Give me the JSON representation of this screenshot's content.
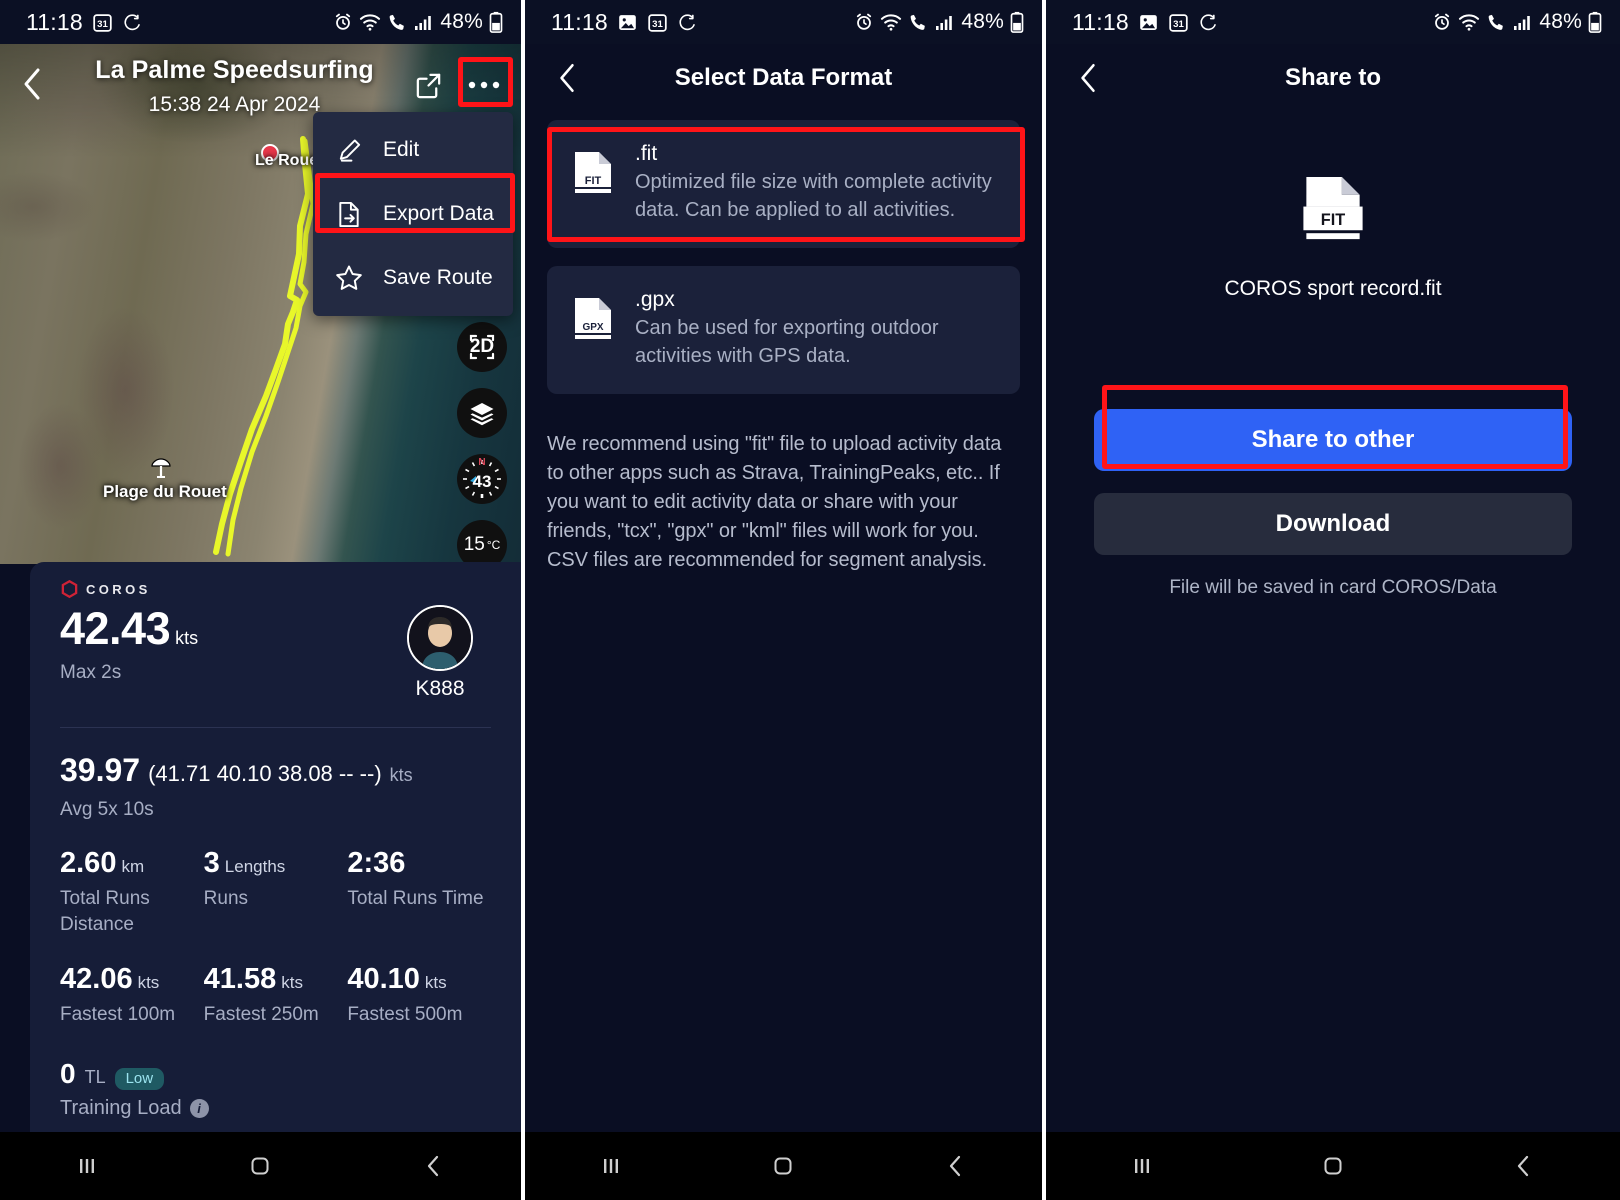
{
  "status_bar": {
    "time": "11:18",
    "battery": "48%",
    "icons_left_screen1": [
      "calendar-31-icon",
      "sync-icon"
    ],
    "icons_left_screen23": [
      "image-icon",
      "calendar-31-icon",
      "sync-icon"
    ],
    "icons_right": [
      "alarm-icon",
      "wifi-icon",
      "call-icon",
      "signal-icon",
      "battery-icon"
    ]
  },
  "screen1": {
    "title": "La Palme Speedsurfing",
    "date": "15:38 24 Apr 2024",
    "back_icon": "chevron-left-icon",
    "share_icon": "share-icon",
    "more_icon": "more-options-icon",
    "menu": [
      {
        "label": "Edit",
        "icon": "pencil-icon"
      },
      {
        "label": "Export Data",
        "icon": "export-file-icon"
      },
      {
        "label": "Save Route",
        "icon": "star-icon"
      }
    ],
    "map_labels": [
      {
        "text": "Le Rouet",
        "icon": "place-dot-icon"
      },
      {
        "text": "Plage du Rouet",
        "icon": "beach-umbrella-icon"
      }
    ],
    "map_controls": [
      {
        "label": "2D",
        "name": "toggle-2d-button"
      },
      {
        "label": "",
        "name": "map-layers-button"
      },
      {
        "label": "43",
        "name": "compass-button",
        "north": "N"
      },
      {
        "label": "15",
        "unit": "°C",
        "name": "temperature-button"
      }
    ],
    "brand": "COROS",
    "hero": {
      "value": "42.43",
      "unit": "kts",
      "label": "Max 2s"
    },
    "user": {
      "name": "K888"
    },
    "avg": {
      "value": "39.97",
      "detail": "(41.71 40.10 38.08 -- --)",
      "unit": "kts",
      "label": "Avg 5x 10s"
    },
    "stats": [
      {
        "value": "2.60",
        "unit": "km",
        "label": "Total Runs Distance"
      },
      {
        "value": "3",
        "unit": "Lengths",
        "label": "Runs"
      },
      {
        "value": "2:36",
        "unit": "",
        "label": "Total Runs Time"
      },
      {
        "value": "42.06",
        "unit": "kts",
        "label": "Fastest 100m"
      },
      {
        "value": "41.58",
        "unit": "kts",
        "label": "Fastest 250m"
      },
      {
        "value": "40.10",
        "unit": "kts",
        "label": "Fastest 500m"
      }
    ],
    "training_load": {
      "value": "0",
      "unit": "TL",
      "badge": "Low",
      "label": "Training Load",
      "info_icon": "info-icon"
    }
  },
  "screen2": {
    "title": "Select Data Format",
    "back_icon": "chevron-left-icon",
    "formats": [
      {
        "name": ".fit",
        "icon_label": "FIT",
        "description": "Optimized file size with complete activity data. Can be applied to all activities.",
        "highlighted": true
      },
      {
        "name": ".gpx",
        "icon_label": "GPX",
        "description": "Can be used for exporting outdoor activities with GPS data.",
        "highlighted": false
      }
    ],
    "note": "We recommend using \"fit\" file to upload activity data to other apps such as Strava, TrainingPeaks, etc.. If you want to edit activity data or share with your friends, \"tcx\", \"gpx\" or \"kml\" files will work for you. CSV files are recommended for segment analysis."
  },
  "screen3": {
    "title": "Share to",
    "back_icon": "chevron-left-icon",
    "file": {
      "icon_label": "FIT",
      "name": "COROS sport record.fit"
    },
    "primary_button": "Share to other",
    "secondary_button": "Download",
    "save_note": "File will be saved in card COROS/Data"
  },
  "nav_bar": {
    "recents": "recents-icon",
    "home": "home-icon",
    "back": "back-icon"
  },
  "colors": {
    "accent_blue": "#2f62f5",
    "highlight_red": "#ff1418",
    "sheet_bg": "#161d38",
    "page_bg": "#0a0e23",
    "card_bg": "#1b213a",
    "track_yellow": "#e8f72a",
    "badge_teal": "#1f5a63"
  }
}
